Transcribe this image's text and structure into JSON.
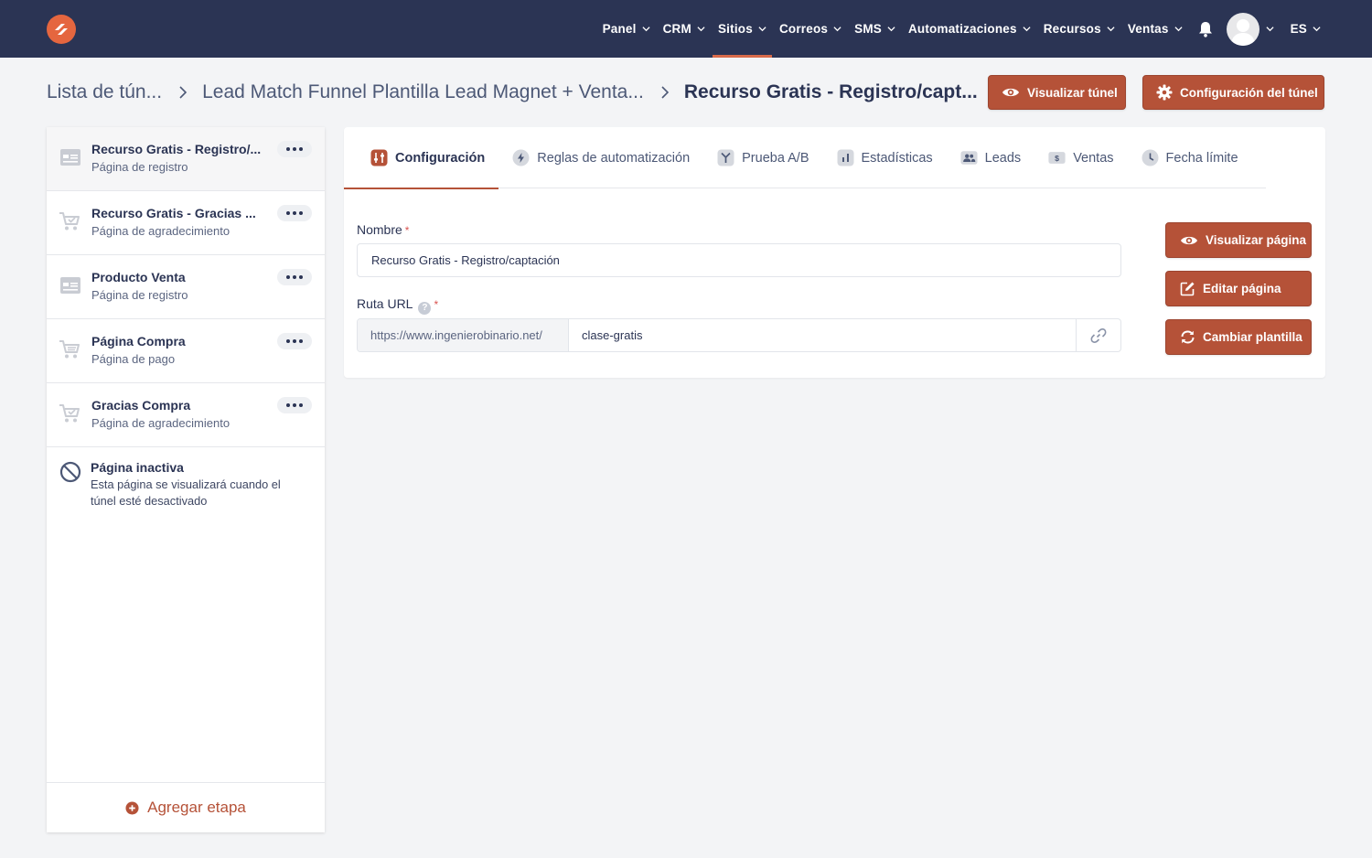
{
  "colors": {
    "navbar": "#2b3454",
    "accent": "#b55238",
    "logo": "#e5663f"
  },
  "nav": {
    "items": [
      {
        "label": "Panel"
      },
      {
        "label": "CRM"
      },
      {
        "label": "Sitios",
        "active": true
      },
      {
        "label": "Correos"
      },
      {
        "label": "SMS"
      },
      {
        "label": "Automatizaciones"
      },
      {
        "label": "Recursos"
      },
      {
        "label": "Ventas"
      }
    ],
    "language": "ES"
  },
  "breadcrumb": {
    "items": [
      "Lista de tún...",
      "Lead Match Funnel Plantilla Lead Magnet + Venta...",
      "Recurso Gratis - Registro/capt..."
    ]
  },
  "header_buttons": {
    "preview_funnel": "Visualizar túnel",
    "funnel_settings": "Configuración del túnel"
  },
  "sidebar": {
    "steps": [
      {
        "title": "Recurso Gratis - Registro/...",
        "subtitle": "Página de registro",
        "icon": "form-page-icon",
        "selected": true
      },
      {
        "title": "Recurso Gratis - Gracias ...",
        "subtitle": "Página de agradecimiento",
        "icon": "cart-check-icon"
      },
      {
        "title": "Producto Venta",
        "subtitle": "Página de registro",
        "icon": "form-page-icon"
      },
      {
        "title": "Página Compra",
        "subtitle": "Página de pago",
        "icon": "cart-icon"
      },
      {
        "title": "Gracias Compra",
        "subtitle": "Página de agradecimiento",
        "icon": "cart-check-icon"
      }
    ],
    "inactive": {
      "title": "Página inactiva",
      "description": "Esta página se visualizará cuando el túnel esté desactivado"
    },
    "add_step": "Agregar etapa"
  },
  "tabs": [
    {
      "label": "Configuración",
      "icon": "sliders-icon",
      "active": true
    },
    {
      "label": "Reglas de automatización",
      "icon": "bolt-icon"
    },
    {
      "label": "Prueba A/B",
      "icon": "split-icon"
    },
    {
      "label": "Estadísticas",
      "icon": "bar-chart-icon"
    },
    {
      "label": "Leads",
      "icon": "users-icon"
    },
    {
      "label": "Ventas",
      "icon": "dollar-icon"
    },
    {
      "label": "Fecha límite",
      "icon": "clock-icon"
    }
  ],
  "form": {
    "name_label": "Nombre",
    "name_value": "Recurso Gratis - Registro/captación",
    "url_label": "Ruta URL",
    "required_mark": "*",
    "help_mark": "?",
    "url_prefix": "https://www.ingenierobinario.net/",
    "url_slug": "clase-gratis"
  },
  "page_actions": {
    "preview_page": "Visualizar página",
    "edit_page": "Editar página",
    "change_template": "Cambiar plantilla"
  }
}
